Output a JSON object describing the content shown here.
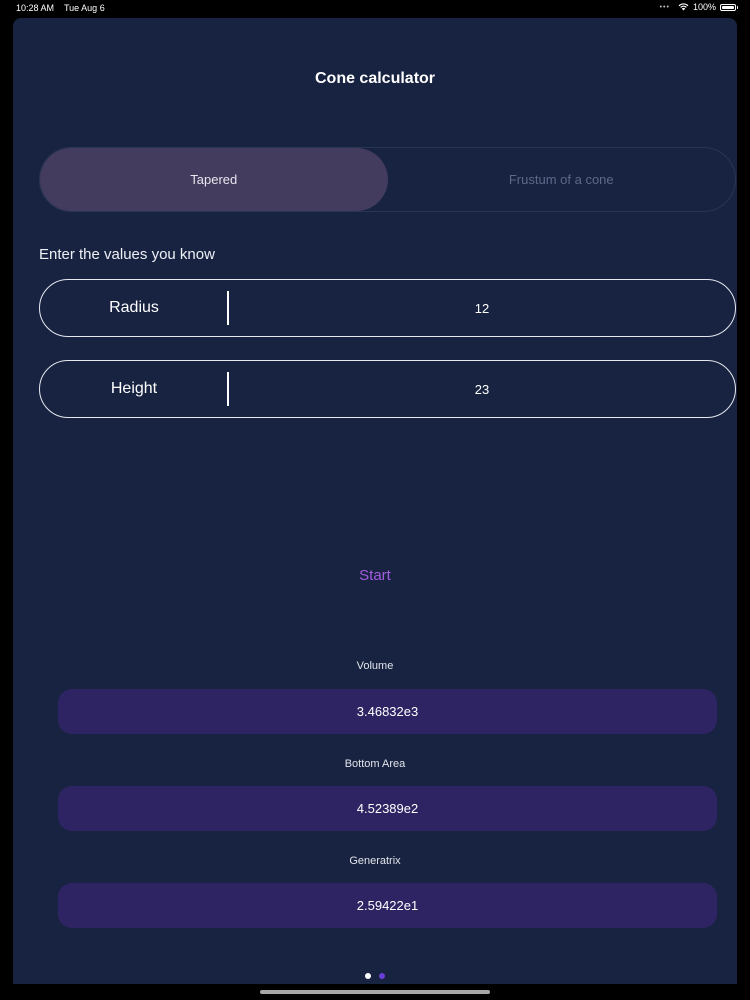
{
  "status_bar": {
    "time": "10:28 AM",
    "date": "Tue Aug 6",
    "battery": "100%"
  },
  "title": "Cone calculator",
  "segments": [
    {
      "label": "Tapered",
      "active": true
    },
    {
      "label": "Frustum of a cone",
      "active": false
    }
  ],
  "prompt": "Enter the values you know",
  "fields": {
    "radius": {
      "label": "Radius",
      "value": "12"
    },
    "height": {
      "label": "Height",
      "value": "23"
    }
  },
  "start_label": "Start",
  "results": [
    {
      "label": "Volume",
      "value": "3.46832e3"
    },
    {
      "label": "Bottom Area",
      "value": "4.52389e2"
    },
    {
      "label": "Generatrix",
      "value": "2.59422e1"
    }
  ],
  "colors": {
    "panel": "#172341",
    "accent": "#a35be0",
    "result_box": "#2f2463",
    "active_segment": "#433c5e"
  },
  "pager": {
    "pages": 2,
    "current": 1
  }
}
